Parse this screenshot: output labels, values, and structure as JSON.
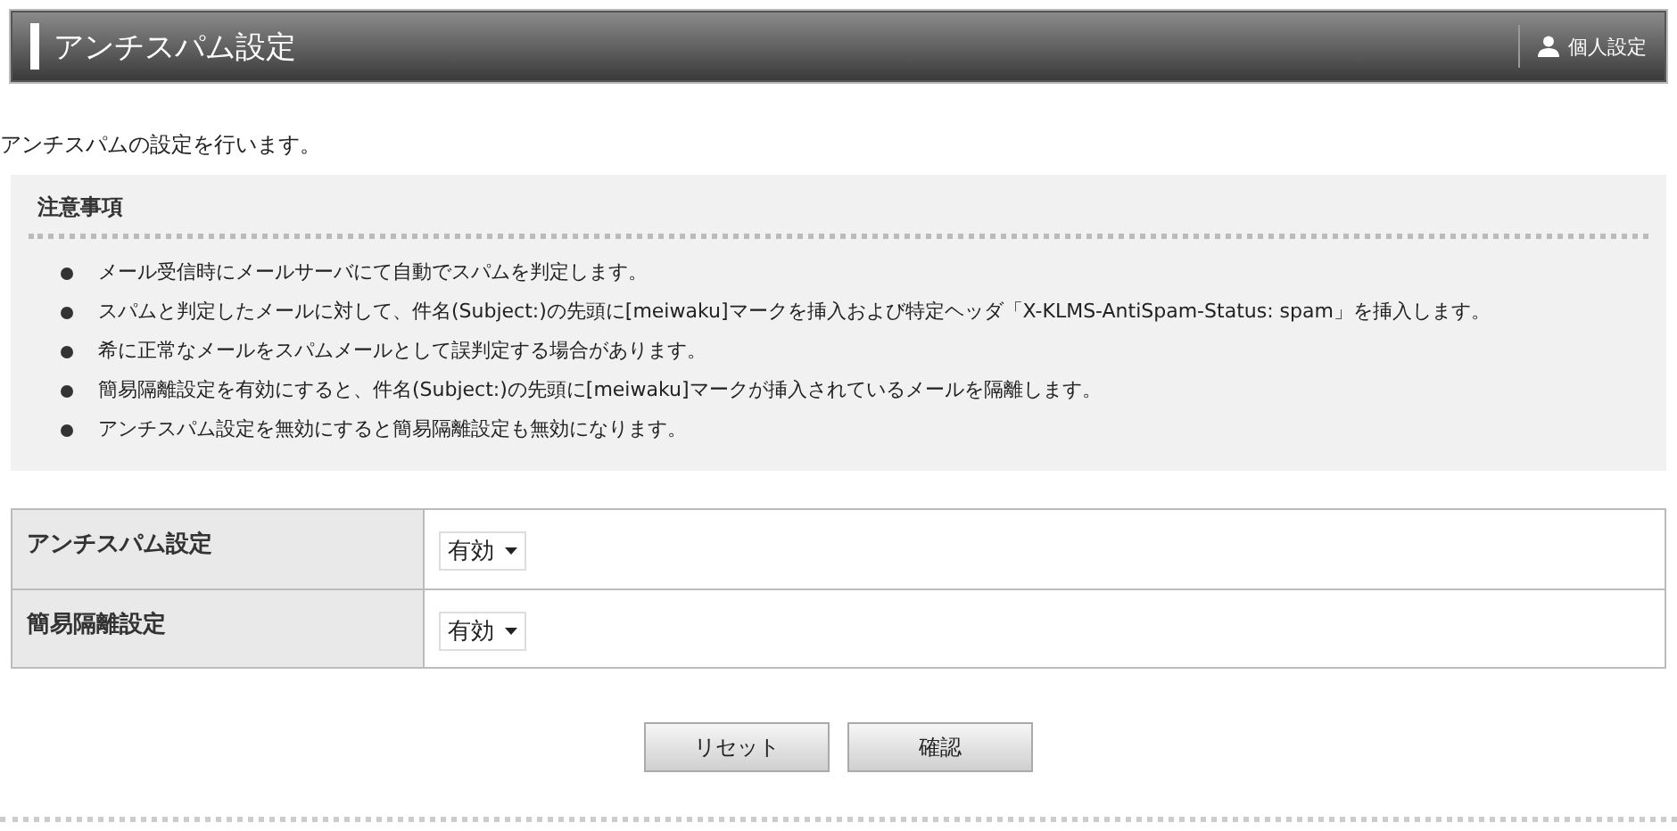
{
  "header": {
    "title": "アンチスパム設定",
    "user_link": "個人設定"
  },
  "intro": "アンチスパムの設定を行います。",
  "notice": {
    "title": "注意事項",
    "items": [
      "メール受信時にメールサーバにて自動でスパムを判定します。",
      "スパムと判定したメールに対して、件名(Subject:)の先頭に[meiwaku]マークを挿入および特定ヘッダ「X-KLMS-AntiSpam-Status: spam」を挿入します。",
      "希に正常なメールをスパムメールとして誤判定する場合があります。",
      "簡易隔離設定を有効にすると、件名(Subject:)の先頭に[meiwaku]マークが挿入されているメールを隔離します。",
      "アンチスパム設定を無効にすると簡易隔離設定も無効になります。"
    ]
  },
  "settings": [
    {
      "label": "アンチスパム設定",
      "value": "有効"
    },
    {
      "label": "簡易隔離設定",
      "value": "有効"
    }
  ],
  "buttons": [
    "リセット",
    "確認"
  ]
}
